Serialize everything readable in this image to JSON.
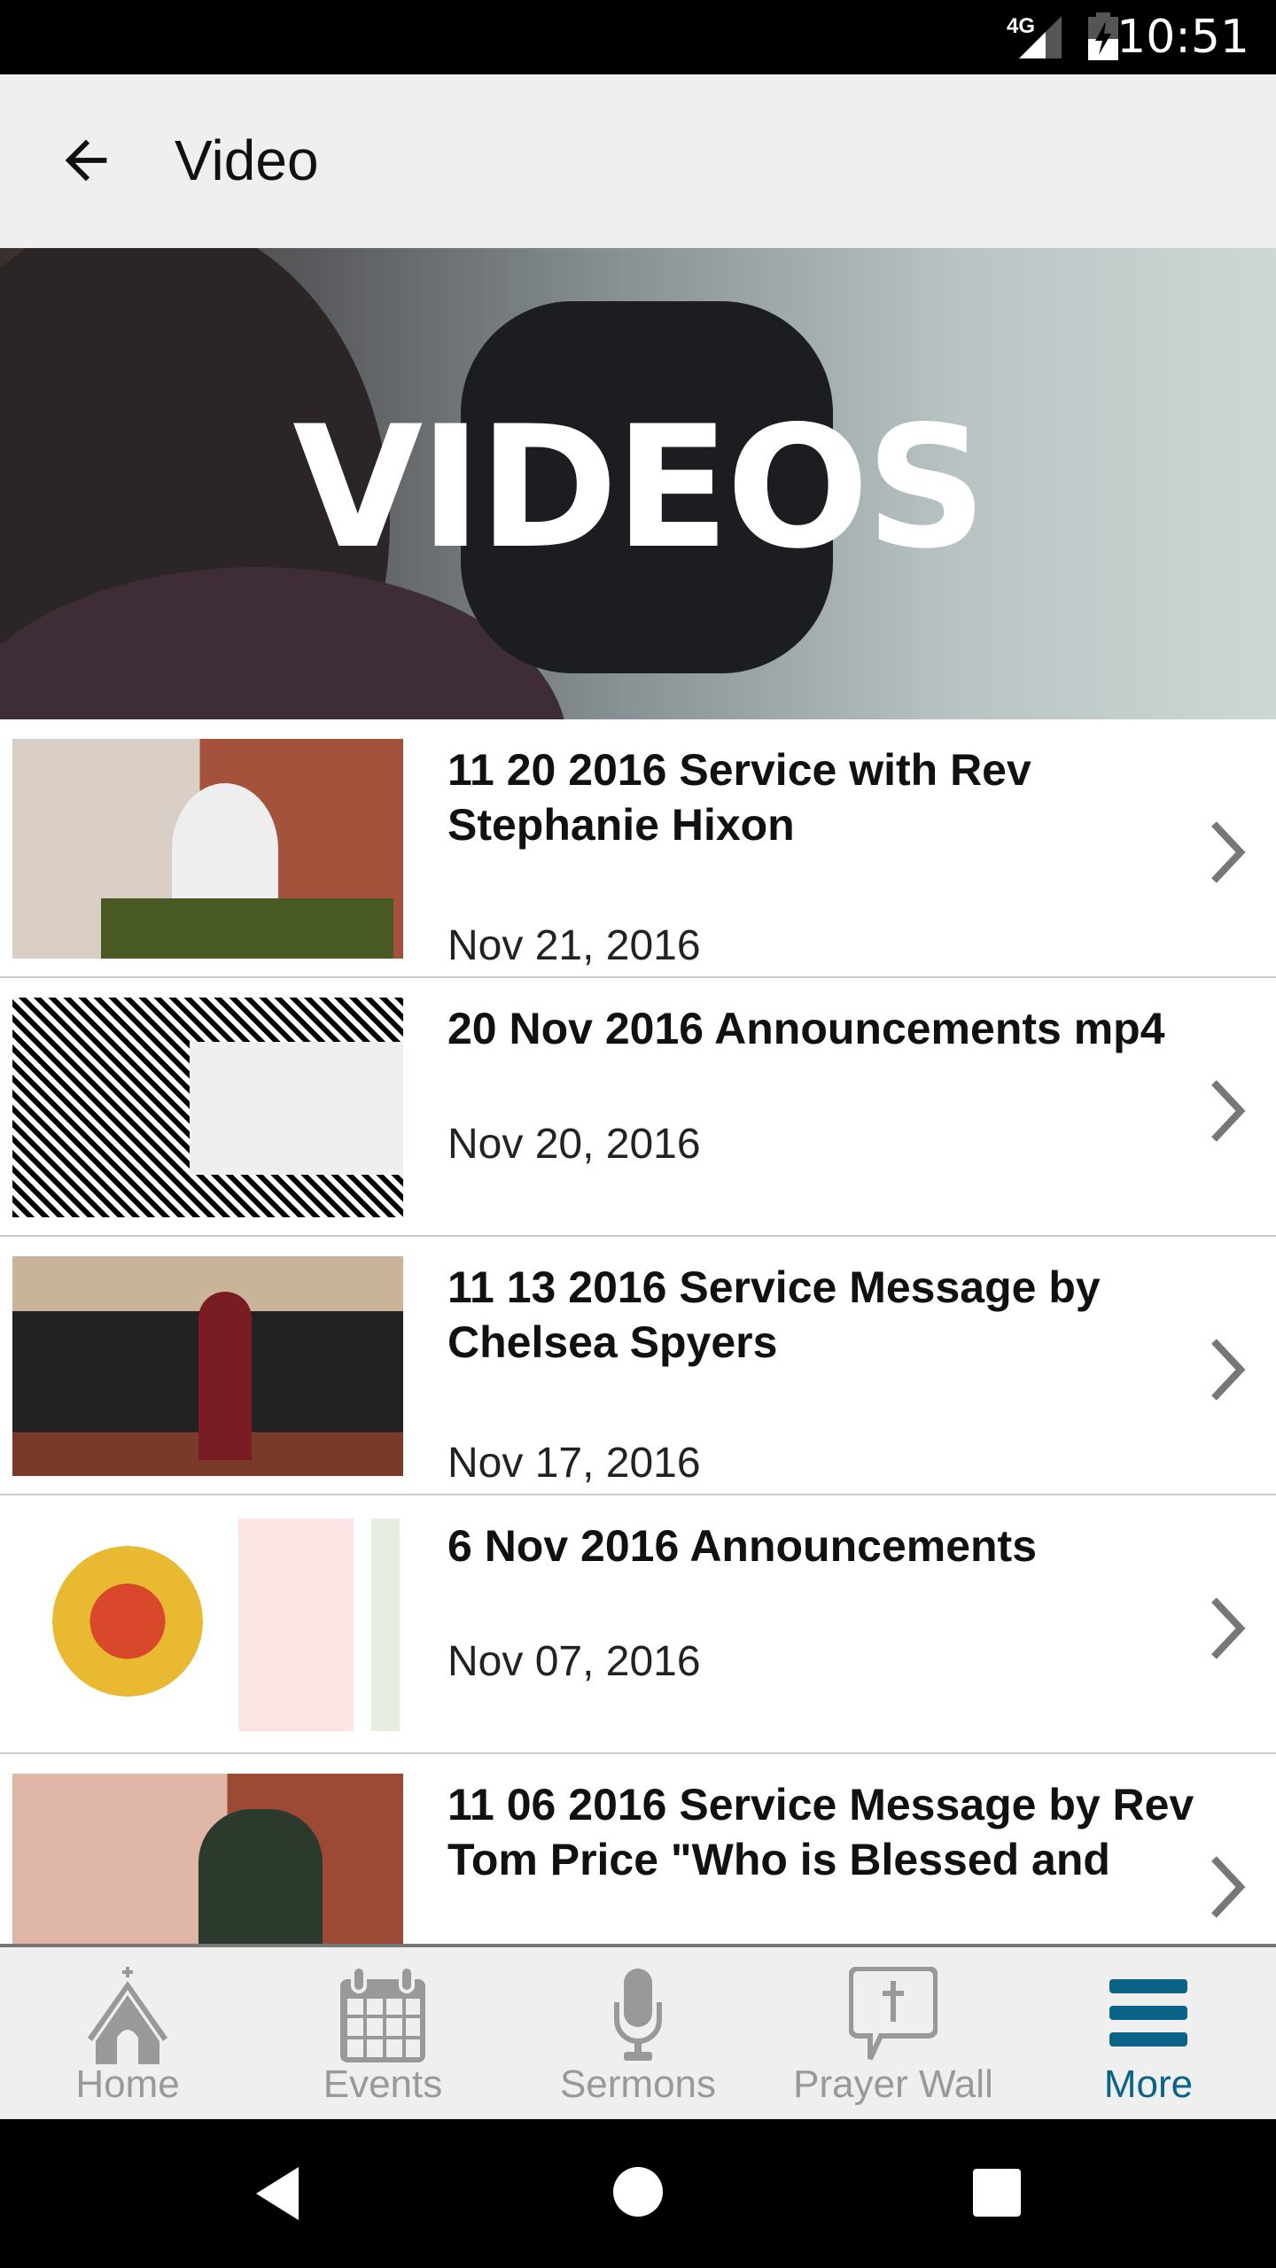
{
  "status_bar": {
    "network": "4G",
    "time": "10:51"
  },
  "app_bar": {
    "title": "Video"
  },
  "banner": {
    "text": "VIDEOS"
  },
  "videos": [
    {
      "title": "11 20 2016 Service with Rev Stephanie Hixon",
      "date": "Nov 21, 2016"
    },
    {
      "title": "20 Nov 2016 Announcements mp4",
      "date": "Nov 20, 2016"
    },
    {
      "title": "11 13 2016 Service Message by Chelsea Spyers",
      "date": "Nov 17, 2016"
    },
    {
      "title": "6 Nov 2016 Announcements",
      "date": "Nov 07, 2016"
    },
    {
      "title": "11 06 2016 Service Message by Rev Tom Price \"Who is Blessed  and",
      "date": ""
    }
  ],
  "bottom_nav": {
    "items": [
      {
        "label": "Home",
        "icon": "church-icon"
      },
      {
        "label": "Events",
        "icon": "calendar-icon"
      },
      {
        "label": "Sermons",
        "icon": "microphone-icon"
      },
      {
        "label": "Prayer Wall",
        "icon": "prayer-bubble-icon"
      },
      {
        "label": "More",
        "icon": "menu-icon",
        "active": true
      }
    ]
  },
  "colors": {
    "accent": "#0b6487",
    "inactive": "#999999"
  }
}
